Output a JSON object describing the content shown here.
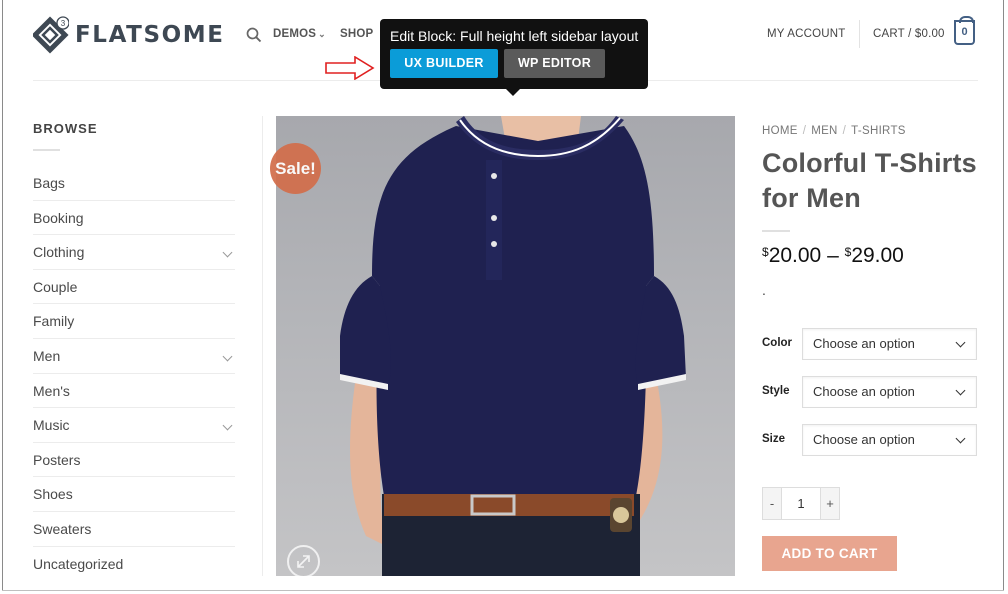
{
  "header": {
    "logo_text": "FLATSOME",
    "logo_badge": "3",
    "nav": [
      {
        "label": "DEMOS",
        "has_caret": true
      },
      {
        "label": "SHOP",
        "has_caret": false
      }
    ],
    "account_label": "MY ACCOUNT",
    "cart_label": "CART / $0.00",
    "cart_count": "0"
  },
  "tooltip": {
    "title": "Edit Block: Full height left sidebar layout",
    "ux_builder_label": "UX BUILDER",
    "wp_editor_label": "WP EDITOR"
  },
  "sidebar": {
    "heading": "BROWSE",
    "categories": [
      {
        "label": "Bags",
        "expandable": false
      },
      {
        "label": "Booking",
        "expandable": false
      },
      {
        "label": "Clothing",
        "expandable": true
      },
      {
        "label": "Couple",
        "expandable": false
      },
      {
        "label": "Family",
        "expandable": false
      },
      {
        "label": "Men",
        "expandable": true
      },
      {
        "label": "Men's",
        "expandable": false
      },
      {
        "label": "Music",
        "expandable": true
      },
      {
        "label": "Posters",
        "expandable": false
      },
      {
        "label": "Shoes",
        "expandable": false
      },
      {
        "label": "Sweaters",
        "expandable": false
      },
      {
        "label": "Uncategorized",
        "expandable": false
      }
    ]
  },
  "product": {
    "sale_badge": "Sale!",
    "breadcrumb": [
      "HOME",
      "MEN",
      "T-SHIRTS"
    ],
    "title": "Colorful T-Shirts for Men",
    "price_currency": "$",
    "price_low": "20.00",
    "price_sep": "–",
    "price_high": "29.00",
    "short_description": ".",
    "variations": [
      {
        "label": "Color",
        "value": "Choose an option"
      },
      {
        "label": "Style",
        "value": "Choose an option"
      },
      {
        "label": "Size",
        "value": "Choose an option"
      }
    ],
    "quantity": {
      "minus": "-",
      "value": "1",
      "plus": "+"
    },
    "add_to_cart_label": "ADD TO CART"
  },
  "colors": {
    "accent_blue": "#0b9cd8",
    "sale": "#d26e4b",
    "add_to_cart": "#e8a58f",
    "brand": "#446084"
  }
}
